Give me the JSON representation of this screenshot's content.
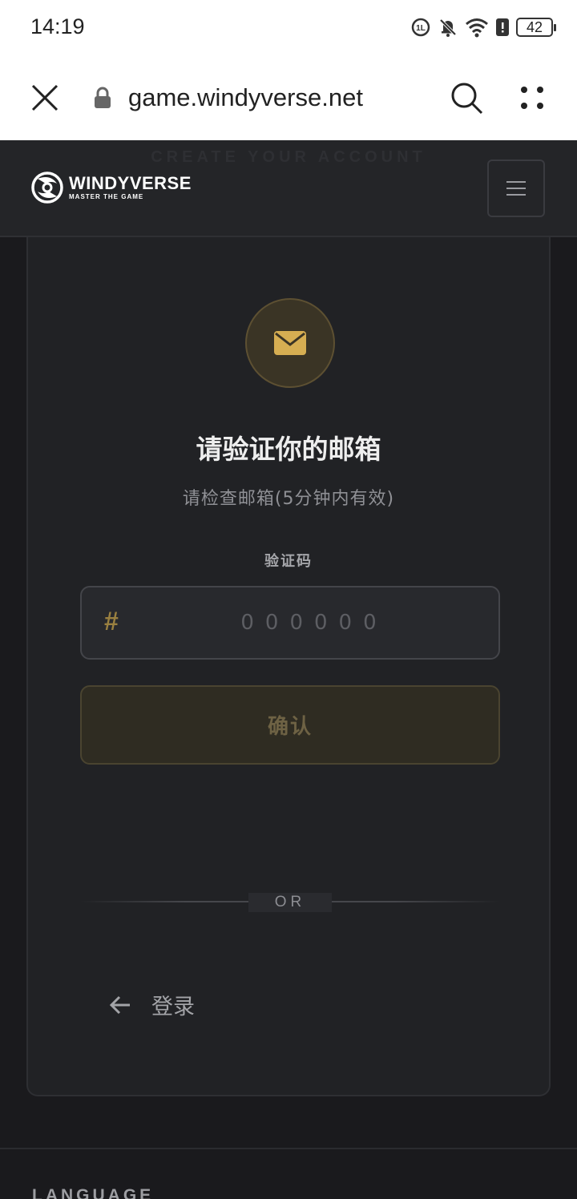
{
  "status_bar": {
    "time": "14:19",
    "battery": "42",
    "icons": [
      "data-saver-icon",
      "mute-icon",
      "wifi-icon",
      "battery-alert-icon",
      "battery-icon"
    ]
  },
  "browser": {
    "url": "game.windyverse.net",
    "icons": [
      "close-icon",
      "lock-icon",
      "search-icon",
      "more-icon"
    ]
  },
  "header": {
    "ghost_heading": "CREATE YOUR ACCOUNT",
    "logo_name": "WINDYVERSE",
    "logo_tagline": "MASTER THE GAME",
    "menu_icon": "hamburger-icon"
  },
  "verify": {
    "icon": "mail-icon",
    "title": "请验证你的邮箱",
    "subtitle": "请检查邮箱(5分钟内有效)",
    "code_label": "验证码",
    "code_icon": "#",
    "code_placeholder": "000000",
    "code_value": "",
    "confirm_label": "确认",
    "or_label": "OR",
    "login_label": "登录"
  },
  "footer": {
    "language_heading": "LANGUAGE"
  },
  "colors": {
    "background": "#1a1a1d",
    "card": "#212225",
    "accent_gold": "#d6ae52",
    "text_primary": "#eeeeee",
    "text_muted": "#8f9095"
  }
}
